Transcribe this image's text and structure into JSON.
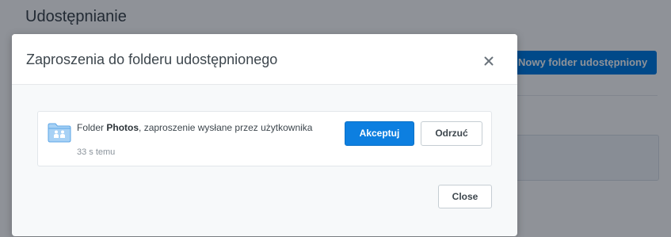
{
  "background": {
    "page_title": "Udostępnianie",
    "new_shared_folder_button": "Nowy folder udostępniony"
  },
  "modal": {
    "title": "Zaproszenia do folderu udostępnionego",
    "close_icon": "close-x-icon",
    "invitation": {
      "prefix": "Folder ",
      "folder_name": "Photos",
      "suffix": ", zaproszenie wysłane przez użytkownika",
      "time_ago": "33 s temu",
      "icon": "shared-folder-icon",
      "accept_label": "Akceptuj",
      "reject_label": "Odrzuć"
    },
    "close_button_label": "Close"
  },
  "colors": {
    "accent": "#0d7fe0",
    "overlay": "rgba(0,6,20,0.44)",
    "folder_icon": "#9ccaf3"
  }
}
